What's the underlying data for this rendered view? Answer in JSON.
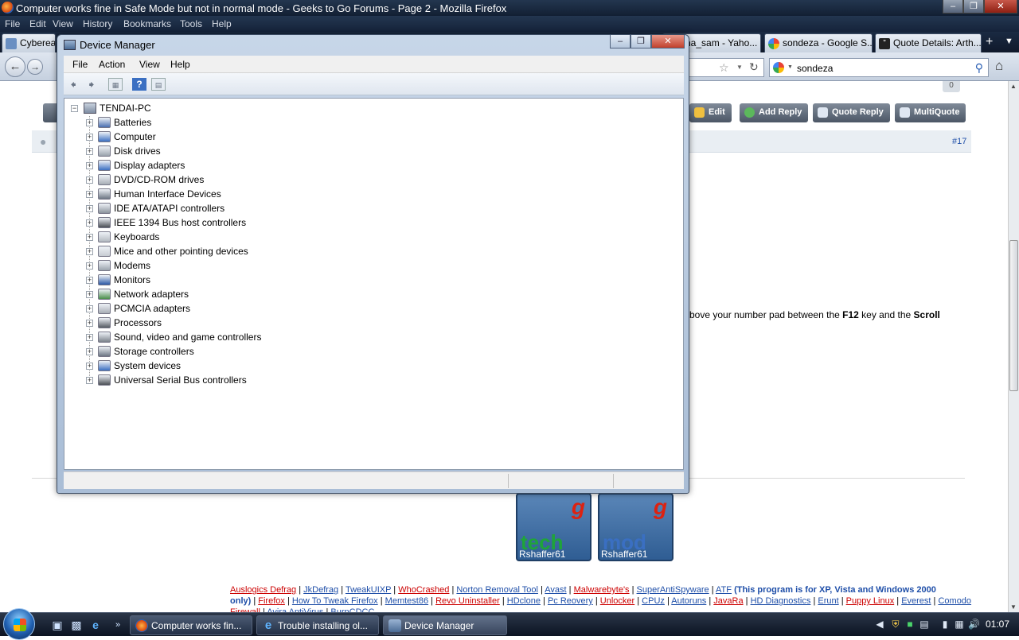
{
  "firefox": {
    "title": "Computer works fine in Safe Mode but not in normal mode - Geeks to Go Forums - Page 2 - Mozilla Firefox",
    "menu": [
      "File",
      "Edit",
      "View",
      "History",
      "Bookmarks",
      "Tools",
      "Help"
    ],
    "tabs": [
      "Cyberea...",
      "ha_sam - Yaho...",
      "sondeza - Google S...",
      "Quote Details: Arth..."
    ],
    "search_value": "sondeza"
  },
  "page": {
    "post_count_badge": "0",
    "buttons": [
      "Edit",
      "Add Reply",
      "Quote Reply",
      "MultiQuote"
    ],
    "post_number": "#17",
    "body_text_a": "bove your number pad between the ",
    "body_key_a": "F12",
    "body_text_b": " key and the ",
    "body_key_b": "Scroll",
    "badge_user_1": "Rshaffer61",
    "badge_user_2": "Rshaffer61",
    "badge_word_1": "tech",
    "badge_word_2": "mod",
    "badge_letter": "g",
    "links_row1": [
      "Auslogics Defrag",
      "JkDefrag",
      "TweakUIXP",
      "WhoCrashed",
      "Norton Removal Tool",
      "Avast",
      "Malwarebyte's",
      "SuperAntiSpyware",
      "ATF"
    ],
    "row1_note": "(This program is for XP, Vista and Windows 2000",
    "row2_note": "only)",
    "links_row2": [
      "Firefox",
      "How To Tweak Firefox",
      "Memtest86",
      "Revo Uninstaller",
      "HDclone",
      "Pc Reovery",
      "Unlocker",
      "CPUz",
      "Autoruns",
      "JavaRa",
      "HD Diagnostics",
      "Erunt",
      "Puppy Linux",
      "Everest",
      "Comodo"
    ],
    "links_row3": [
      "Firewall",
      "Avira AntiVirus",
      "BurnCDCC"
    ]
  },
  "device_manager": {
    "title": "Device Manager",
    "menu": [
      "File",
      "Action",
      "View",
      "Help"
    ],
    "root": "TENDAI-PC",
    "categories": [
      "Batteries",
      "Computer",
      "Disk drives",
      "Display adapters",
      "DVD/CD-ROM drives",
      "Human Interface Devices",
      "IDE ATA/ATAPI controllers",
      "IEEE 1394 Bus host controllers",
      "Keyboards",
      "Mice and other pointing devices",
      "Modems",
      "Monitors",
      "Network adapters",
      "PCMCIA adapters",
      "Processors",
      "Sound, video and game controllers",
      "Storage controllers",
      "System devices",
      "Universal Serial Bus controllers"
    ]
  },
  "taskbar": {
    "buttons": [
      "Computer works fin...",
      "Trouble installing ol...",
      "Device Manager"
    ],
    "clock": "01:07"
  }
}
